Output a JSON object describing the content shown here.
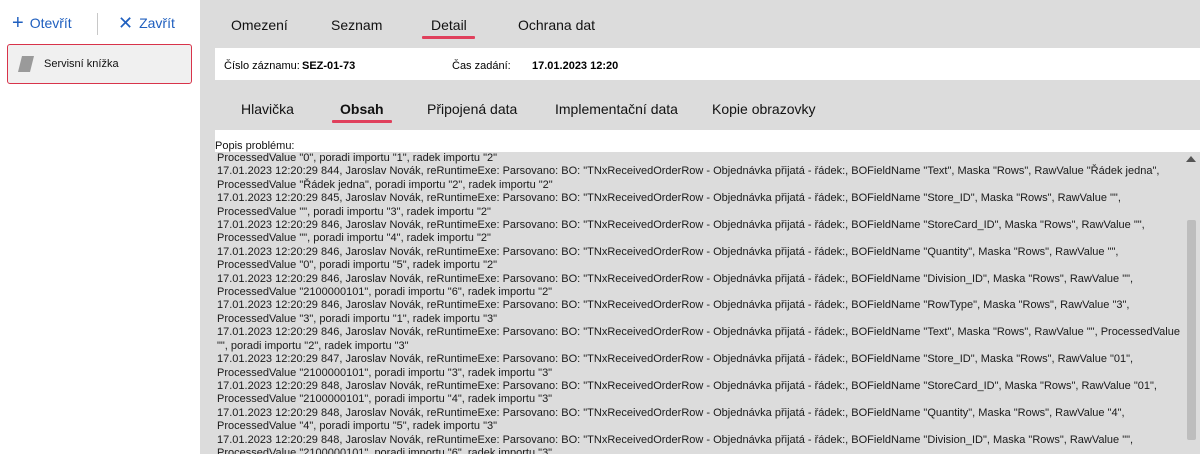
{
  "toolbar": {
    "open_label": "Otevřít",
    "close_label": "Zavřít"
  },
  "sidebar": {
    "items": [
      {
        "label": "Servisní knížka"
      }
    ]
  },
  "top_tabs": [
    {
      "label": "Omezení"
    },
    {
      "label": "Seznam"
    },
    {
      "label": "Detail"
    },
    {
      "label": "Ochrana dat"
    }
  ],
  "record": {
    "number_label": "Číslo záznamu:",
    "number_value": "SEZ-01-73",
    "time_label": "Čas zadání:",
    "time_value": "17.01.2023 12:20"
  },
  "sub_tabs": [
    {
      "label": "Hlavička"
    },
    {
      "label": "Obsah"
    },
    {
      "label": "Připojená data"
    },
    {
      "label": "Implementační data"
    },
    {
      "label": "Kopie obrazovky"
    }
  ],
  "content": {
    "problem_label": "Popis problému:",
    "lines": [
      "ProcessedValue \"0\", poradi importu \"1\", radek importu \"2\"",
      "17.01.2023 12:20:29 844, Jaroslav Novák, reRuntimeExe: Parsovano: BO: \"TNxReceivedOrderRow - Objednávka přijatá - řádek:, BOFieldName \"Text\", Maska \"Rows\", RawValue \"Řádek jedna\",",
      "ProcessedValue \"Řádek jedna\", poradi importu \"2\", radek importu \"2\"",
      "17.01.2023 12:20:29 845, Jaroslav Novák, reRuntimeExe: Parsovano: BO: \"TNxReceivedOrderRow - Objednávka přijatá - řádek:, BOFieldName \"Store_ID\", Maska \"Rows\", RawValue \"\",",
      "ProcessedValue \"\", poradi importu \"3\", radek importu \"2\"",
      "17.01.2023 12:20:29 846, Jaroslav Novák, reRuntimeExe: Parsovano: BO: \"TNxReceivedOrderRow - Objednávka přijatá - řádek:, BOFieldName \"StoreCard_ID\", Maska \"Rows\", RawValue \"\",",
      "ProcessedValue \"\", poradi importu \"4\", radek importu \"2\"",
      "17.01.2023 12:20:29 846, Jaroslav Novák, reRuntimeExe: Parsovano: BO: \"TNxReceivedOrderRow - Objednávka přijatá - řádek:, BOFieldName \"Quantity\", Maska \"Rows\", RawValue \"\",",
      "ProcessedValue \"0\", poradi importu \"5\", radek importu \"2\"",
      "17.01.2023 12:20:29 846, Jaroslav Novák, reRuntimeExe: Parsovano: BO: \"TNxReceivedOrderRow - Objednávka přijatá - řádek:, BOFieldName \"Division_ID\", Maska \"Rows\", RawValue \"\",",
      "ProcessedValue \"2100000101\", poradi importu \"6\", radek importu \"2\"",
      "17.01.2023 12:20:29 846, Jaroslav Novák, reRuntimeExe: Parsovano: BO: \"TNxReceivedOrderRow - Objednávka přijatá - řádek:, BOFieldName \"RowType\", Maska \"Rows\", RawValue \"3\",",
      "ProcessedValue \"3\", poradi importu \"1\", radek importu \"3\"",
      "17.01.2023 12:20:29 846, Jaroslav Novák, reRuntimeExe: Parsovano: BO: \"TNxReceivedOrderRow - Objednávka přijatá - řádek:, BOFieldName \"Text\", Maska \"Rows\", RawValue \"\", ProcessedValue",
      "\"\", poradi importu \"2\", radek importu \"3\"",
      "17.01.2023 12:20:29 847, Jaroslav Novák, reRuntimeExe: Parsovano: BO: \"TNxReceivedOrderRow - Objednávka přijatá - řádek:, BOFieldName \"Store_ID\", Maska \"Rows\", RawValue \"01\",",
      "ProcessedValue \"2100000101\", poradi importu \"3\", radek importu \"3\"",
      "17.01.2023 12:20:29 848, Jaroslav Novák, reRuntimeExe: Parsovano: BO: \"TNxReceivedOrderRow - Objednávka přijatá - řádek:, BOFieldName \"StoreCard_ID\", Maska \"Rows\", RawValue \"01\",",
      "ProcessedValue \"2100000101\", poradi importu \"4\", radek importu \"3\"",
      "17.01.2023 12:20:29 848, Jaroslav Novák, reRuntimeExe: Parsovano: BO: \"TNxReceivedOrderRow - Objednávka přijatá - řádek:, BOFieldName \"Quantity\", Maska \"Rows\", RawValue \"4\",",
      "ProcessedValue \"4\", poradi importu \"5\", radek importu \"3\"",
      "17.01.2023 12:20:29 848, Jaroslav Novák, reRuntimeExe: Parsovano: BO: \"TNxReceivedOrderRow - Objednávka přijatá - řádek:, BOFieldName \"Division_ID\", Maska \"Rows\", RawValue \"\",",
      "ProcessedValue \"2100000101\", poradi importu \"6\", radek importu \"3\""
    ]
  },
  "icons": {
    "open": "plus-icon",
    "close": "x-icon",
    "record": "flag-icon"
  },
  "colors": {
    "accent": "#e0405c",
    "link": "#1f5fbf",
    "panel_bg": "#dcdcdc"
  }
}
